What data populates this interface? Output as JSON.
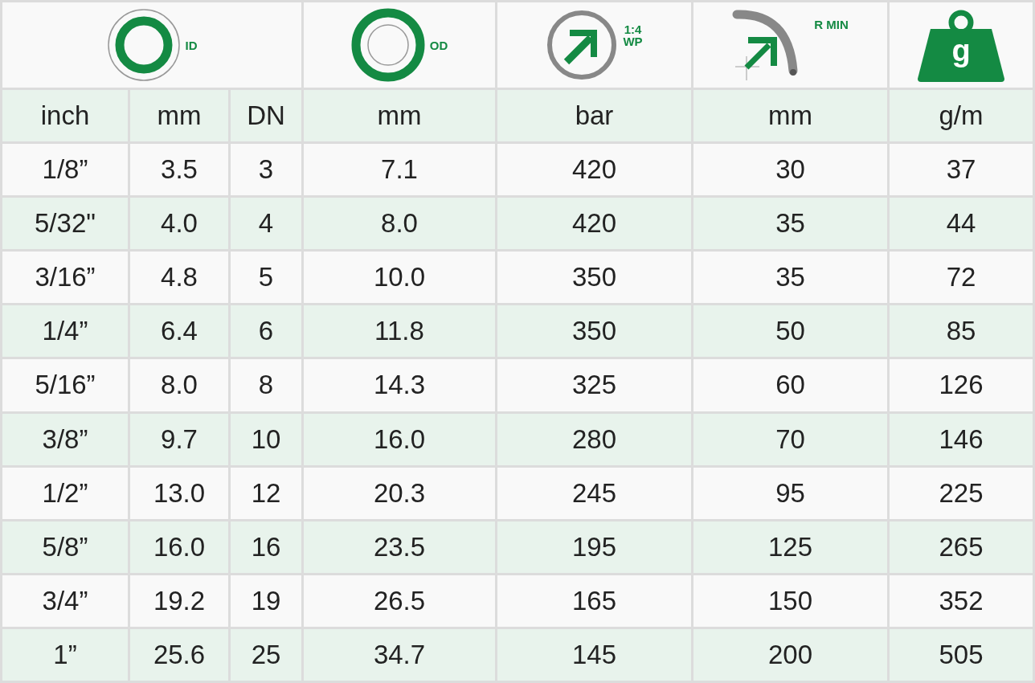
{
  "header": [
    {
      "kind": "id",
      "label": "ID"
    },
    {
      "kind": "od",
      "label": "OD"
    },
    {
      "kind": "wp",
      "ratio": "1:4",
      "label": "WP"
    },
    {
      "kind": "rmin",
      "label": "R MIN"
    },
    {
      "kind": "weight",
      "label": "g"
    }
  ],
  "units": [
    "inch",
    "mm",
    "DN",
    "mm",
    "bar",
    "mm",
    "g/m"
  ],
  "rows": [
    [
      "1/8”",
      "3.5",
      "3",
      "7.1",
      "420",
      "30",
      "37"
    ],
    [
      "5/32\"",
      "4.0",
      "4",
      "8.0",
      "420",
      "35",
      "44"
    ],
    [
      "3/16”",
      "4.8",
      "5",
      "10.0",
      "350",
      "35",
      "72"
    ],
    [
      "1/4”",
      "6.4",
      "6",
      "11.8",
      "350",
      "50",
      "85"
    ],
    [
      "5/16”",
      "8.0",
      "8",
      "14.3",
      "325",
      "60",
      "126"
    ],
    [
      "3/8”",
      "9.7",
      "10",
      "16.0",
      "280",
      "70",
      "146"
    ],
    [
      "1/2”",
      "13.0",
      "12",
      "20.3",
      "245",
      "95",
      "225"
    ],
    [
      "5/8”",
      "16.0",
      "16",
      "23.5",
      "195",
      "125",
      "265"
    ],
    [
      "3/4”",
      "19.2",
      "19",
      "26.5",
      "165",
      "150",
      "352"
    ],
    [
      "1”",
      "25.6",
      "25",
      "34.7",
      "145",
      "200",
      "505"
    ]
  ]
}
